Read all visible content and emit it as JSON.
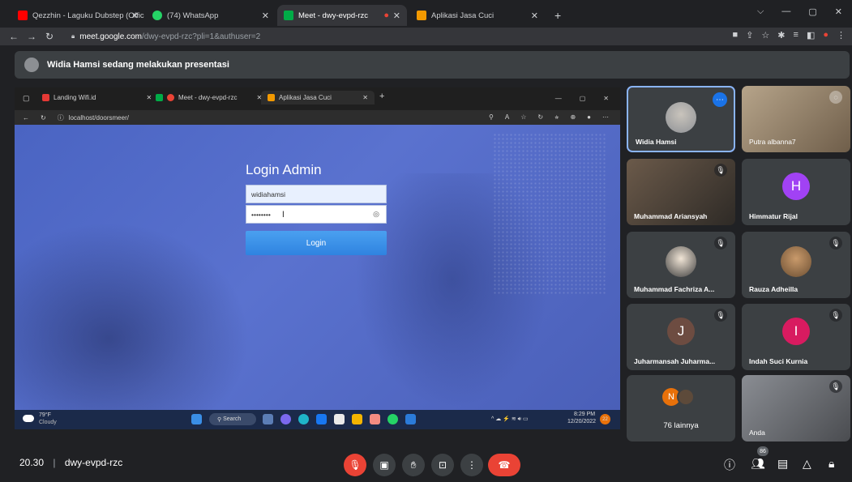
{
  "browser": {
    "tabs": [
      {
        "label": "Qezzhin - Laguku Dubstep (Offic",
        "icon": "youtube-icon",
        "color": "#ff0000"
      },
      {
        "label": "(74) WhatsApp",
        "icon": "whatsapp-icon",
        "color": "#25d366"
      },
      {
        "label": "Meet - dwy-evpd-rzc",
        "icon": "meet-icon",
        "color": "#00ac47"
      },
      {
        "label": "Aplikasi Jasa Cuci",
        "icon": "app-icon",
        "color": "#f29900"
      }
    ],
    "new_tab": "+",
    "url_host": "meet.google.com",
    "url_path": "/dwy-evpd-rzc?pli=1&authuser=2"
  },
  "presentation_bar": {
    "text": "Widia Hamsi sedang melakukan presentasi"
  },
  "shared_screen": {
    "tabs": [
      {
        "label": "Landing Wifi.id"
      },
      {
        "label": "Meet - dwy-evpd-rzc"
      },
      {
        "label": "Aplikasi Jasa Cuci"
      }
    ],
    "new_tab": "+",
    "url": "localhost/doorsmeer/",
    "login": {
      "title": "Login Admin",
      "username": "widiahamsi",
      "password": "••••••••",
      "button": "Login"
    },
    "taskbar": {
      "weather_temp": "79°F",
      "weather_text": "Cloudy",
      "search": "Search",
      "time": "8:29 PM",
      "date": "12/20/2022",
      "notif": "22"
    }
  },
  "participants": [
    {
      "name": "Widia Hamsi",
      "kind": "photo",
      "selected": true
    },
    {
      "name": "Putra albanna7",
      "kind": "video"
    },
    {
      "name": "Muhammad Ariansyah",
      "kind": "video",
      "muted": true
    },
    {
      "name": "Himmatur Rijal",
      "kind": "letter",
      "letter": "H",
      "color": "#a142f4"
    },
    {
      "name": "Muhammad Fachriza A...",
      "kind": "photo",
      "muted": true
    },
    {
      "name": "Rauza Adheilla",
      "kind": "photo",
      "muted": true
    },
    {
      "name": "Juharmansah Juharma...",
      "kind": "letter",
      "letter": "J",
      "color": "#6d4c41",
      "muted": true
    },
    {
      "name": "Indah Suci Kurnia",
      "kind": "letter",
      "letter": "I",
      "color": "#d81b60",
      "muted": true
    },
    {
      "name": "76 lainnya",
      "kind": "group",
      "letter": "N"
    },
    {
      "name": "Anda",
      "kind": "video",
      "muted": true
    }
  ],
  "bottom_bar": {
    "time": "20.30",
    "separator": "|",
    "meeting_code": "dwy-evpd-rzc",
    "people_count": "86"
  }
}
